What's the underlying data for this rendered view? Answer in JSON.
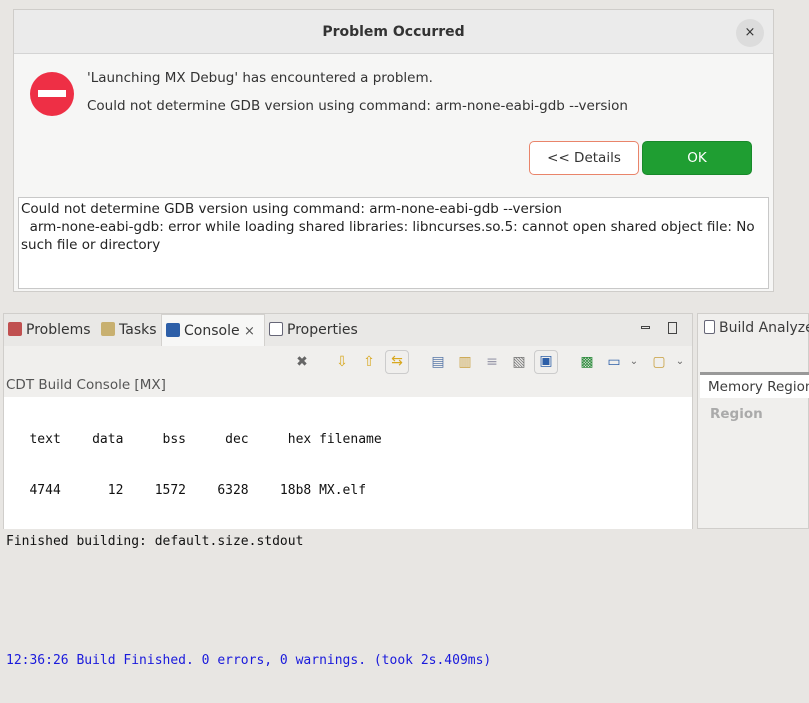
{
  "dialog": {
    "title": "Problem Occurred",
    "close": "×",
    "message": "'Launching MX Debug' has encountered a problem.",
    "detail_short": "Could not determine GDB version using command: arm-none-eabi-gdb --version",
    "details_button": "<< Details",
    "ok_button": "OK",
    "details_text": "Could not determine GDB version using command: arm-none-eabi-gdb --version\n  arm-none-eabi-gdb: error while loading shared libraries: libncurses.so.5: cannot open shared object file: No such file or directory"
  },
  "panel": {
    "tabs": [
      {
        "label": "Problems",
        "icon": "problems-icon"
      },
      {
        "label": "Tasks",
        "icon": "tasks-icon"
      },
      {
        "label": "Console",
        "icon": "console-icon",
        "close": "×"
      },
      {
        "label": "Properties",
        "icon": "properties-icon"
      }
    ],
    "console_label": "CDT Build Console [MX]",
    "console_lines": [
      "   text    data     bss     dec     hex filename",
      "   4744      12    1572    6328    18b8 MX.elf",
      "Finished building: default.size.stdout",
      "",
      ""
    ],
    "build_finished": "12:36:26 Build Finished. 0 errors, 0 warnings. (took 2s.409ms)",
    "build_color": "#1a1adc"
  },
  "right_panel": {
    "tab": "Build Analyzer",
    "subtab": "Memory Regions",
    "column": "Region"
  }
}
